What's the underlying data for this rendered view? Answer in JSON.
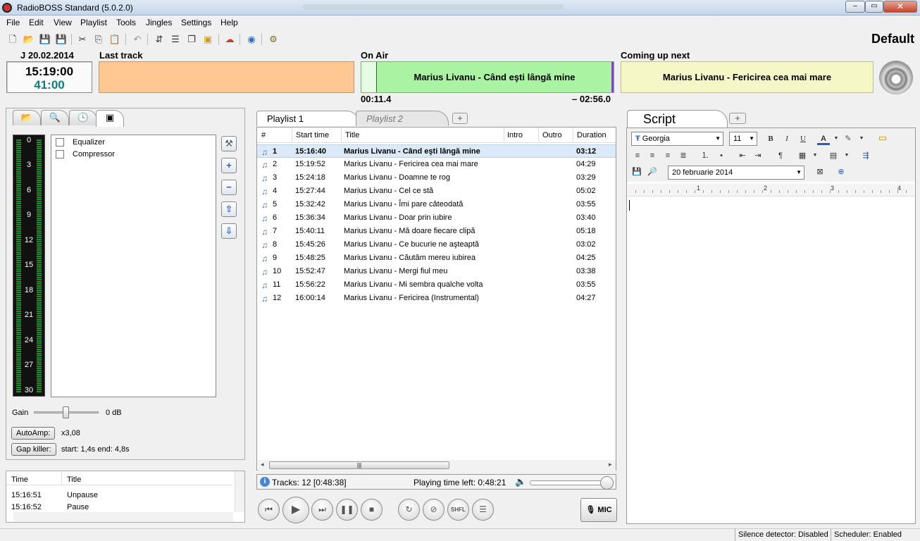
{
  "window": {
    "title": "RadioBOSS Standard (5.0.2.0)",
    "controls": [
      "–",
      "▭",
      "✕"
    ]
  },
  "menu": [
    "File",
    "Edit",
    "View",
    "Playlist",
    "Tools",
    "Jingles",
    "Settings",
    "Help"
  ],
  "profile": "Default",
  "header": {
    "date": "J 20.02.2014",
    "time": "15:19:00",
    "countdown": "41:00",
    "last_track_label": "Last track",
    "last_track": "",
    "on_air_label": "On Air",
    "on_air": "Marius Livanu - Când eşti lângă mine",
    "elapsed": "00:11.4",
    "remaining": "– 02:56.0",
    "coming_up_label": "Coming up next",
    "coming_up": "Marius Livanu - Fericirea cea mai mare"
  },
  "effects": {
    "vu_labels": [
      "0",
      "3",
      "6",
      "9",
      "12",
      "15",
      "18",
      "21",
      "24",
      "27",
      "30"
    ],
    "items": [
      {
        "label": "Equalizer",
        "checked": false
      },
      {
        "label": "Compressor",
        "checked": false
      }
    ],
    "gain_label": "Gain",
    "gain_value": "0 dB",
    "gain_level_db": 0,
    "autoamp_label": "AutoAmp:",
    "autoamp_value": "x3,08",
    "gapkiller_label": "Gap killer:",
    "gapkiller_value": "start: 1,4s end: 4,8s"
  },
  "log": {
    "columns": [
      "Time",
      "Title"
    ],
    "rows": [
      {
        "time": "15:16:51",
        "title": "Unpause"
      },
      {
        "time": "15:16:52",
        "title": "Pause"
      }
    ]
  },
  "playlist": {
    "tabs": [
      "Playlist 1",
      "Playlist 2"
    ],
    "columns": [
      "#",
      "Start time",
      "Title",
      "Intro",
      "Outro",
      "Duration"
    ],
    "rows": [
      {
        "n": "1",
        "start": "15:16:40",
        "title": "Marius Livanu - Când eşti lângă mine",
        "duration": "03:12"
      },
      {
        "n": "2",
        "start": "15:19:52",
        "title": "Marius Livanu - Fericirea cea mai mare",
        "duration": "04:29"
      },
      {
        "n": "3",
        "start": "15:24:18",
        "title": "Marius Livanu - Doamne te rog",
        "duration": "03:29"
      },
      {
        "n": "4",
        "start": "15:27:44",
        "title": "Marius Livanu - Cel ce stă",
        "duration": "05:02"
      },
      {
        "n": "5",
        "start": "15:32:42",
        "title": "Marius Livanu - Îmi pare câteodată",
        "duration": "03:55"
      },
      {
        "n": "6",
        "start": "15:36:34",
        "title": "Marius Livanu - Doar prin iubire",
        "duration": "03:40"
      },
      {
        "n": "7",
        "start": "15:40:11",
        "title": "Marius Livanu - Mă doare fiecare clipă",
        "duration": "05:18"
      },
      {
        "n": "8",
        "start": "15:45:26",
        "title": "Marius Livanu - Ce bucurie ne aşteaptă",
        "duration": "03:02"
      },
      {
        "n": "9",
        "start": "15:48:25",
        "title": "Marius Livanu - Căutăm mereu iubirea",
        "duration": "04:25"
      },
      {
        "n": "10",
        "start": "15:52:47",
        "title": "Marius Livanu - Mergi fiul meu",
        "duration": "03:38"
      },
      {
        "n": "11",
        "start": "15:56:22",
        "title": "Marius Livanu - Mi sembra qualche volta",
        "duration": "03:55"
      },
      {
        "n": "12",
        "start": "16:00:14",
        "title": "Marius Livanu - Fericirea (Instrumental)",
        "duration": "04:27"
      }
    ],
    "tracks_info": "Tracks: 12 [0:48:38]",
    "playing_time_left": "Playing time left: 0:48:21",
    "volume_level": 0.92,
    "mic_label": "MIC",
    "shfl_label": "SHFL"
  },
  "script": {
    "tab": "Script",
    "font": "Georgia",
    "size": "11",
    "date": "20  februarie  2014",
    "ruler": [
      "1",
      "2",
      "3",
      "4"
    ]
  },
  "statusbar": {
    "silence": "Silence detector: Disabled",
    "scheduler": "Scheduler: Enabled"
  }
}
